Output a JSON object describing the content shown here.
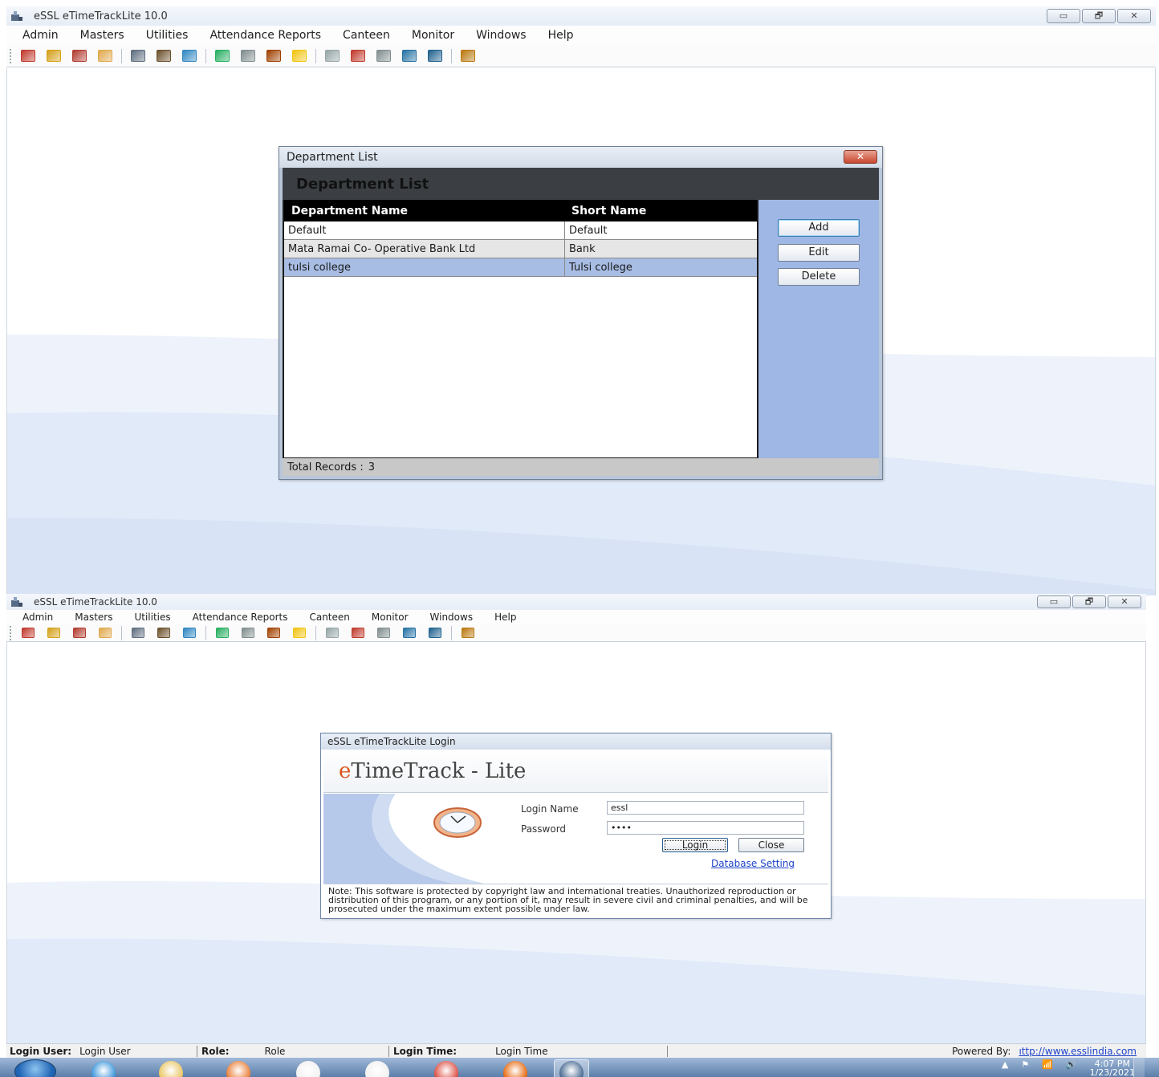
{
  "app_title": "eSSL eTimeTrackLite 10.0",
  "window_controls": [
    "▭",
    "🗗",
    "✕"
  ],
  "menu": [
    "Admin",
    "Masters",
    "Utilities",
    "Attendance Reports",
    "Canteen",
    "Monitor",
    "Windows",
    "Help"
  ],
  "toolbar_icons": [
    {
      "name": "users-icon",
      "color": "#c0392b"
    },
    {
      "name": "key-icon",
      "color": "#d4a017"
    },
    {
      "name": "exit-icon",
      "color": "#b03a2e"
    },
    {
      "name": "printer-icon",
      "color": "#e0a84a"
    },
    {
      "sep": true
    },
    {
      "name": "grid-icon",
      "color": "#5d6d7e"
    },
    {
      "name": "people-icon",
      "color": "#6b4f2a"
    },
    {
      "name": "book-icon",
      "color": "#2e86c1"
    },
    {
      "sep": true
    },
    {
      "name": "device-icon",
      "color": "#27ae60"
    },
    {
      "name": "calendar-icon",
      "color": "#7f8c8d"
    },
    {
      "name": "checklist-icon",
      "color": "#a04000"
    },
    {
      "name": "report-icon",
      "color": "#f1c40f"
    },
    {
      "sep": true
    },
    {
      "name": "pen-icon",
      "color": "#95a5a6"
    },
    {
      "name": "tools-icon",
      "color": "#c0392b"
    },
    {
      "name": "tools-gray-icon",
      "color": "#7f8c8d"
    },
    {
      "name": "group-icon",
      "color": "#2471a3"
    },
    {
      "name": "group-alt-icon",
      "color": "#1f618d"
    },
    {
      "sep": true
    },
    {
      "name": "printer-alt-icon",
      "color": "#b9770e"
    }
  ],
  "department_dialog": {
    "window_title": "Department List",
    "header": "Department List",
    "columns": [
      "Department Name",
      "Short Name"
    ],
    "rows": [
      {
        "name": "Default",
        "short": "Default"
      },
      {
        "name": "Mata Ramai Co- Operative Bank Ltd",
        "short": "Bank"
      },
      {
        "name": "tulsi college",
        "short": "Tulsi college"
      }
    ],
    "selected_row": 2,
    "buttons": {
      "add": "Add",
      "edit": "Edit",
      "delete": "Delete"
    },
    "total_label": "Total Records :",
    "total_value": "3",
    "close_glyph": "✕"
  },
  "login_dialog": {
    "window_title": "eSSL eTimeTrackLite Login",
    "brand_first": "e",
    "brand_rest": "TimeTrack - Lite",
    "login_name_label": "Login Name",
    "login_name_value": "essl",
    "password_label": "Password",
    "password_value": "••••",
    "login_button": "Login",
    "close_button": "Close",
    "database_link": "Database Setting",
    "note": "Note: This software is protected by copyright law and international treaties. Unauthorized reproduction or distribution of this program, or any portion of it, may result in severe civil and criminal penalties, and will be prosecuted under the maximum extent possible under law."
  },
  "statusbar": {
    "login_user_label": "Login User:",
    "login_user_value": "Login User",
    "role_label": "Role:",
    "role_value": "Role",
    "login_time_label": "Login Time:",
    "login_time_value": "Login Time",
    "powered_label": "Powered By:",
    "powered_link": "ıttp://www.esslindia.com"
  },
  "taskbar": {
    "apps": [
      {
        "name": "ie-icon",
        "color": "#2f8fd8"
      },
      {
        "name": "explorer-icon",
        "color": "#e8c25a"
      },
      {
        "name": "media-icon",
        "color": "#e8782c"
      },
      {
        "name": "app-hand-icon",
        "color": "#f0f0f0"
      },
      {
        "name": "clock-app-icon",
        "color": "#f0f0f0"
      },
      {
        "name": "chrome-icon",
        "color": "#db4437"
      },
      {
        "name": "firefox-icon",
        "color": "#e66000"
      },
      {
        "name": "etimetrack-icon",
        "color": "#3b5f8a"
      }
    ],
    "time": "4:07 PM",
    "date": "1/23/2021",
    "tray_icons": [
      "▲",
      "⚑",
      "📶",
      "🔊"
    ]
  }
}
